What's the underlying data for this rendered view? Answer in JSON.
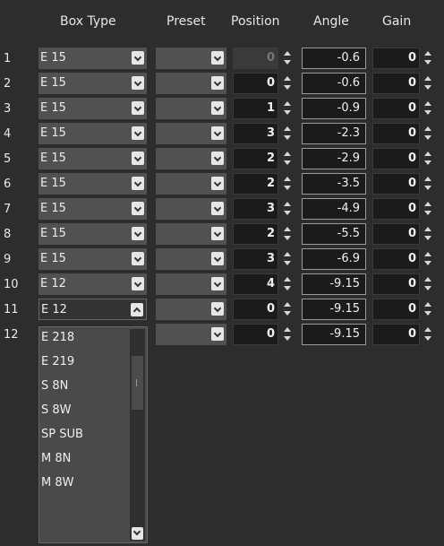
{
  "headers": {
    "box_type": "Box Type",
    "preset": "Preset",
    "position": "Position",
    "angle": "Angle",
    "gain": "Gain"
  },
  "rows": [
    {
      "num": "1",
      "box": "E 15",
      "position": "0",
      "angle": "-0.6",
      "gain": "0",
      "position_disabled": true
    },
    {
      "num": "2",
      "box": "E 15",
      "position": "0",
      "angle": "-0.6",
      "gain": "0"
    },
    {
      "num": "3",
      "box": "E 15",
      "position": "1",
      "angle": "-0.9",
      "gain": "0"
    },
    {
      "num": "4",
      "box": "E 15",
      "position": "3",
      "angle": "-2.3",
      "gain": "0"
    },
    {
      "num": "5",
      "box": "E 15",
      "position": "2",
      "angle": "-2.9",
      "gain": "0"
    },
    {
      "num": "6",
      "box": "E 15",
      "position": "2",
      "angle": "-3.5",
      "gain": "0"
    },
    {
      "num": "7",
      "box": "E 15",
      "position": "3",
      "angle": "-4.9",
      "gain": "0"
    },
    {
      "num": "8",
      "box": "E 15",
      "position": "2",
      "angle": "-5.5",
      "gain": "0"
    },
    {
      "num": "9",
      "box": "E 15",
      "position": "3",
      "angle": "-6.9",
      "gain": "0"
    },
    {
      "num": "10",
      "box": "E 12",
      "position": "4",
      "angle": "-9.15",
      "gain": "0"
    },
    {
      "num": "11",
      "box": "E 12",
      "position": "0",
      "angle": "-9.15",
      "gain": "0",
      "box_open": true
    },
    {
      "num": "12",
      "box": "",
      "position": "0",
      "angle": "-9.15",
      "gain": "0",
      "box_hidden": true
    }
  ],
  "dropdown_options": [
    "E 218",
    "E 219",
    "S 8N",
    "S 8W",
    "SP SUB",
    "M 8N",
    "M 8W"
  ],
  "colors": {
    "background": "#2d2d2d",
    "combo": "#515151",
    "field": "#1b1b1b"
  }
}
